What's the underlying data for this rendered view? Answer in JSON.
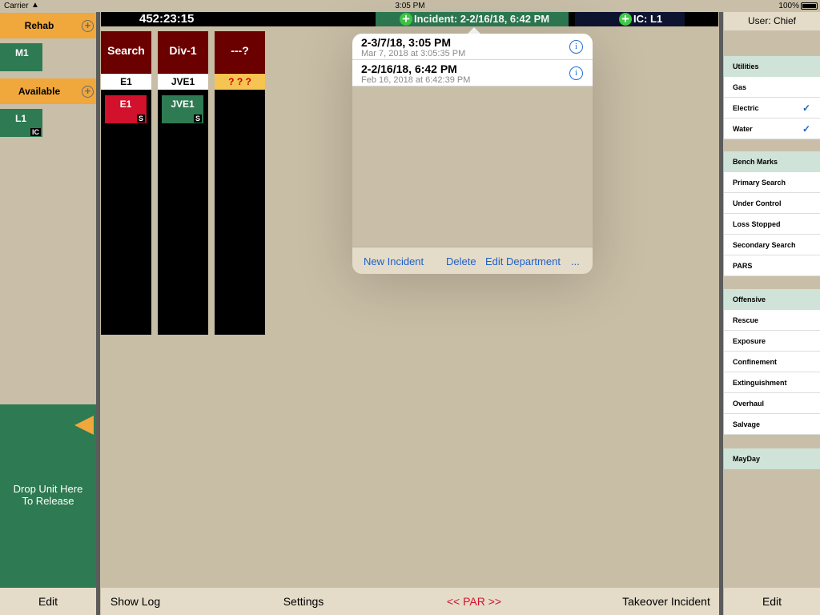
{
  "status_bar": {
    "carrier": "Carrier",
    "time": "3:05 PM",
    "battery": "100%"
  },
  "top_bar": {
    "timer": "452:23:15",
    "incident_label": "Incident: 2-2/16/18, 6:42 PM",
    "ic_label": "IC: L1"
  },
  "left_panel": {
    "groups": [
      {
        "label": "Rehab",
        "units": [
          {
            "name": "M1",
            "tag": ""
          }
        ]
      },
      {
        "label": "Available",
        "units": [
          {
            "name": "L1",
            "tag": "IC"
          }
        ]
      }
    ],
    "drop_zone_line1": "Drop Unit Here",
    "drop_zone_line2": "To Release",
    "edit_label": "Edit"
  },
  "columns": [
    {
      "title": "Search",
      "sub": "E1",
      "sub_warn": false,
      "unit": "E1",
      "unit_tag": "S",
      "unit_color": "#d2112c"
    },
    {
      "title": "Div-1",
      "sub": "JVE1",
      "sub_warn": false,
      "unit": "JVE1",
      "unit_tag": "S",
      "unit_color": "#2e7a52"
    },
    {
      "title": "---?",
      "sub": "? ? ?",
      "sub_warn": true,
      "unit": "",
      "unit_tag": "",
      "unit_color": ""
    }
  ],
  "popover": {
    "items": [
      {
        "title": "2-3/7/18, 3:05 PM",
        "subtitle": "Mar 7, 2018 at 3:05:35 PM"
      },
      {
        "title": "2-2/16/18, 6:42 PM",
        "subtitle": "Feb 16, 2018 at 6:42:39 PM"
      }
    ],
    "footer": {
      "new_incident": "New Incident",
      "delete": "Delete",
      "edit_department": "Edit Department",
      "more": "..."
    }
  },
  "bottom_bar": {
    "show_log": "Show Log",
    "settings": "Settings",
    "par": "<< PAR >>",
    "takeover": "Takeover Incident"
  },
  "right_panel": {
    "user": "User: Chief",
    "sections": [
      {
        "title": "Utilities",
        "items": [
          {
            "label": "Gas",
            "checked": false
          },
          {
            "label": "Electric",
            "checked": true
          },
          {
            "label": "Water",
            "checked": true
          }
        ]
      },
      {
        "title": "Bench Marks",
        "items": [
          {
            "label": "Primary Search",
            "checked": false
          },
          {
            "label": "Under Control",
            "checked": false
          },
          {
            "label": "Loss Stopped",
            "checked": false
          },
          {
            "label": "Secondary Search",
            "checked": false
          },
          {
            "label": "PARS",
            "checked": false
          }
        ]
      },
      {
        "title": "Offensive",
        "items": [
          {
            "label": "Rescue",
            "checked": false
          },
          {
            "label": "Exposure",
            "checked": false
          },
          {
            "label": "Confinement",
            "checked": false
          },
          {
            "label": "Extinguishment",
            "checked": false
          },
          {
            "label": "Overhaul",
            "checked": false
          },
          {
            "label": "Salvage",
            "checked": false
          }
        ]
      },
      {
        "title": "MayDay",
        "items": []
      }
    ],
    "edit_label": "Edit"
  },
  "colors": {
    "background": "#c8bda5",
    "green": "#2e7a52",
    "orange": "#f0a73c",
    "dark_red": "#6b0000",
    "red": "#d2112c",
    "link_blue": "#1f5fc6",
    "par_red": "#d2112c"
  }
}
